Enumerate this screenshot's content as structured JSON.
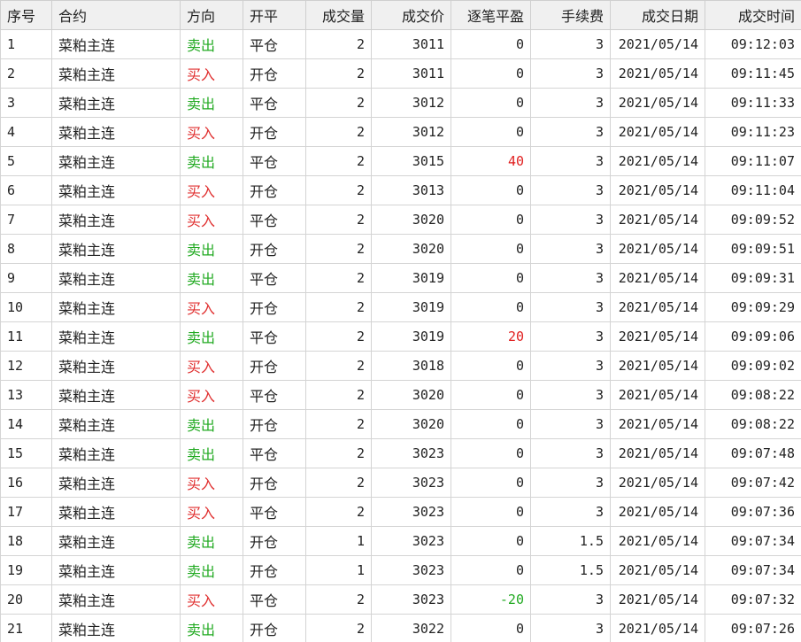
{
  "table": {
    "headers": {
      "index": "序号",
      "contract": "合约",
      "direction": "方向",
      "open_close": "开平",
      "volume": "成交量",
      "price": "成交价",
      "pnl": "逐笔平盈",
      "fee": "手续费",
      "date": "成交日期",
      "time": "成交时间"
    },
    "rows": [
      {
        "index": "1",
        "contract": "菜粕主连",
        "direction": "卖出",
        "open_close": "平仓",
        "volume": "2",
        "price": "3011",
        "pnl": "0",
        "fee": "3",
        "date": "2021/05/14",
        "time": "09:12:03"
      },
      {
        "index": "2",
        "contract": "菜粕主连",
        "direction": "买入",
        "open_close": "开仓",
        "volume": "2",
        "price": "3011",
        "pnl": "0",
        "fee": "3",
        "date": "2021/05/14",
        "time": "09:11:45"
      },
      {
        "index": "3",
        "contract": "菜粕主连",
        "direction": "卖出",
        "open_close": "平仓",
        "volume": "2",
        "price": "3012",
        "pnl": "0",
        "fee": "3",
        "date": "2021/05/14",
        "time": "09:11:33"
      },
      {
        "index": "4",
        "contract": "菜粕主连",
        "direction": "买入",
        "open_close": "开仓",
        "volume": "2",
        "price": "3012",
        "pnl": "0",
        "fee": "3",
        "date": "2021/05/14",
        "time": "09:11:23"
      },
      {
        "index": "5",
        "contract": "菜粕主连",
        "direction": "卖出",
        "open_close": "平仓",
        "volume": "2",
        "price": "3015",
        "pnl": "40",
        "fee": "3",
        "date": "2021/05/14",
        "time": "09:11:07"
      },
      {
        "index": "6",
        "contract": "菜粕主连",
        "direction": "买入",
        "open_close": "开仓",
        "volume": "2",
        "price": "3013",
        "pnl": "0",
        "fee": "3",
        "date": "2021/05/14",
        "time": "09:11:04"
      },
      {
        "index": "7",
        "contract": "菜粕主连",
        "direction": "买入",
        "open_close": "平仓",
        "volume": "2",
        "price": "3020",
        "pnl": "0",
        "fee": "3",
        "date": "2021/05/14",
        "time": "09:09:52"
      },
      {
        "index": "8",
        "contract": "菜粕主连",
        "direction": "卖出",
        "open_close": "开仓",
        "volume": "2",
        "price": "3020",
        "pnl": "0",
        "fee": "3",
        "date": "2021/05/14",
        "time": "09:09:51"
      },
      {
        "index": "9",
        "contract": "菜粕主连",
        "direction": "卖出",
        "open_close": "平仓",
        "volume": "2",
        "price": "3019",
        "pnl": "0",
        "fee": "3",
        "date": "2021/05/14",
        "time": "09:09:31"
      },
      {
        "index": "10",
        "contract": "菜粕主连",
        "direction": "买入",
        "open_close": "开仓",
        "volume": "2",
        "price": "3019",
        "pnl": "0",
        "fee": "3",
        "date": "2021/05/14",
        "time": "09:09:29"
      },
      {
        "index": "11",
        "contract": "菜粕主连",
        "direction": "卖出",
        "open_close": "平仓",
        "volume": "2",
        "price": "3019",
        "pnl": "20",
        "fee": "3",
        "date": "2021/05/14",
        "time": "09:09:06"
      },
      {
        "index": "12",
        "contract": "菜粕主连",
        "direction": "买入",
        "open_close": "开仓",
        "volume": "2",
        "price": "3018",
        "pnl": "0",
        "fee": "3",
        "date": "2021/05/14",
        "time": "09:09:02"
      },
      {
        "index": "13",
        "contract": "菜粕主连",
        "direction": "买入",
        "open_close": "平仓",
        "volume": "2",
        "price": "3020",
        "pnl": "0",
        "fee": "3",
        "date": "2021/05/14",
        "time": "09:08:22"
      },
      {
        "index": "14",
        "contract": "菜粕主连",
        "direction": "卖出",
        "open_close": "开仓",
        "volume": "2",
        "price": "3020",
        "pnl": "0",
        "fee": "3",
        "date": "2021/05/14",
        "time": "09:08:22"
      },
      {
        "index": "15",
        "contract": "菜粕主连",
        "direction": "卖出",
        "open_close": "平仓",
        "volume": "2",
        "price": "3023",
        "pnl": "0",
        "fee": "3",
        "date": "2021/05/14",
        "time": "09:07:48"
      },
      {
        "index": "16",
        "contract": "菜粕主连",
        "direction": "买入",
        "open_close": "开仓",
        "volume": "2",
        "price": "3023",
        "pnl": "0",
        "fee": "3",
        "date": "2021/05/14",
        "time": "09:07:42"
      },
      {
        "index": "17",
        "contract": "菜粕主连",
        "direction": "买入",
        "open_close": "平仓",
        "volume": "2",
        "price": "3023",
        "pnl": "0",
        "fee": "3",
        "date": "2021/05/14",
        "time": "09:07:36"
      },
      {
        "index": "18",
        "contract": "菜粕主连",
        "direction": "卖出",
        "open_close": "开仓",
        "volume": "1",
        "price": "3023",
        "pnl": "0",
        "fee": "1.5",
        "date": "2021/05/14",
        "time": "09:07:34"
      },
      {
        "index": "19",
        "contract": "菜粕主连",
        "direction": "卖出",
        "open_close": "开仓",
        "volume": "1",
        "price": "3023",
        "pnl": "0",
        "fee": "1.5",
        "date": "2021/05/14",
        "time": "09:07:34"
      },
      {
        "index": "20",
        "contract": "菜粕主连",
        "direction": "买入",
        "open_close": "平仓",
        "volume": "2",
        "price": "3023",
        "pnl": "-20",
        "fee": "3",
        "date": "2021/05/14",
        "time": "09:07:32"
      },
      {
        "index": "21",
        "contract": "菜粕主连",
        "direction": "卖出",
        "open_close": "开仓",
        "volume": "2",
        "price": "3022",
        "pnl": "0",
        "fee": "3",
        "date": "2021/05/14",
        "time": "09:07:26"
      }
    ]
  },
  "colors": {
    "sell": "#22aa22",
    "buy": "#e03030",
    "pnl_positive": "#e02020",
    "pnl_negative": "#22aa22",
    "header_bg": "#f0f0f0",
    "grid_line": "#d4d4d4"
  }
}
